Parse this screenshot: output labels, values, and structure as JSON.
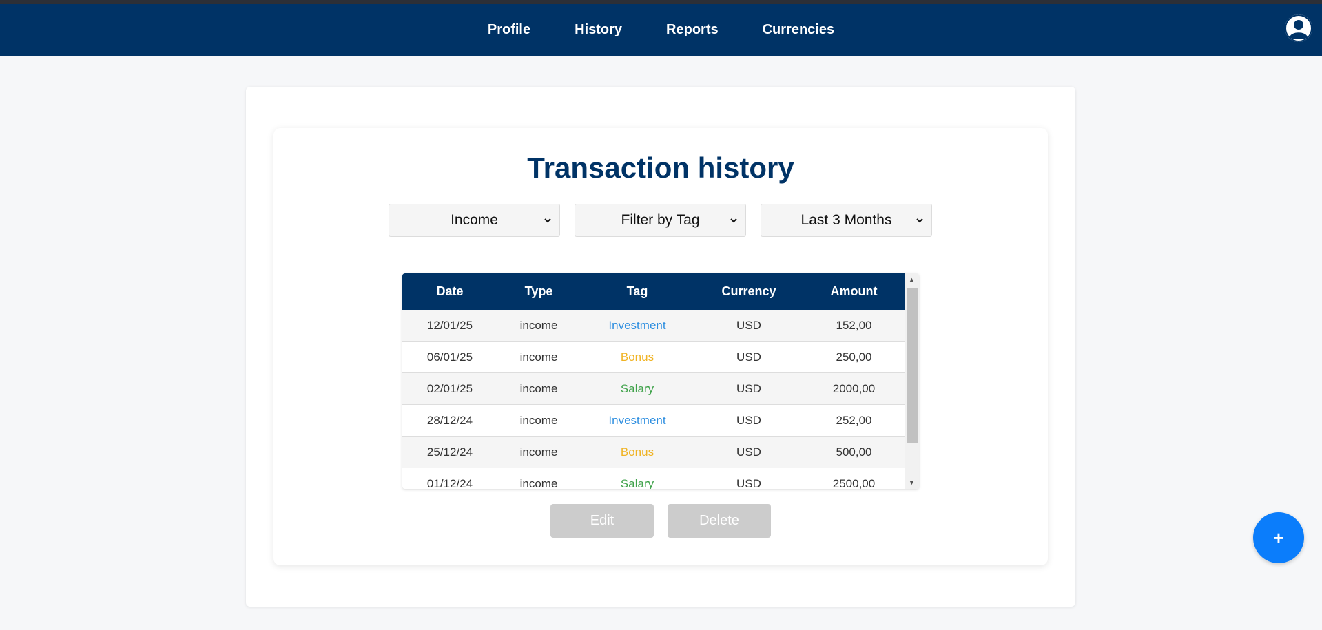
{
  "nav": {
    "links": [
      "Profile",
      "History",
      "Reports",
      "Currencies"
    ],
    "avatar_icon": "user-avatar-icon"
  },
  "page": {
    "title": "Transaction history"
  },
  "filters": {
    "type": "Income",
    "tag": "Filter by Tag",
    "period": "Last 3 Months"
  },
  "table": {
    "columns": [
      "Date",
      "Type",
      "Tag",
      "Currency",
      "Amount"
    ],
    "rows": [
      {
        "date": "12/01/25",
        "type": "income",
        "tag": "Investment",
        "currency": "USD",
        "amount": "152,00"
      },
      {
        "date": "06/01/25",
        "type": "income",
        "tag": "Bonus",
        "currency": "USD",
        "amount": "250,00"
      },
      {
        "date": "02/01/25",
        "type": "income",
        "tag": "Salary",
        "currency": "USD",
        "amount": "2000,00"
      },
      {
        "date": "28/12/24",
        "type": "income",
        "tag": "Investment",
        "currency": "USD",
        "amount": "252,00"
      },
      {
        "date": "25/12/24",
        "type": "income",
        "tag": "Bonus",
        "currency": "USD",
        "amount": "500,00"
      },
      {
        "date": "01/12/24",
        "type": "income",
        "tag": "Salary",
        "currency": "USD",
        "amount": "2500,00"
      }
    ]
  },
  "tag_colors": {
    "Investment": "#2f8fe0",
    "Bonus": "#f0b323",
    "Salary": "#3fa24a"
  },
  "actions": {
    "edit": "Edit",
    "delete": "Delete",
    "add": "+"
  },
  "colors": {
    "navbar": "#003366",
    "title": "#003366",
    "fab": "#0b7dfb",
    "disabled_button": "#cccccc"
  }
}
